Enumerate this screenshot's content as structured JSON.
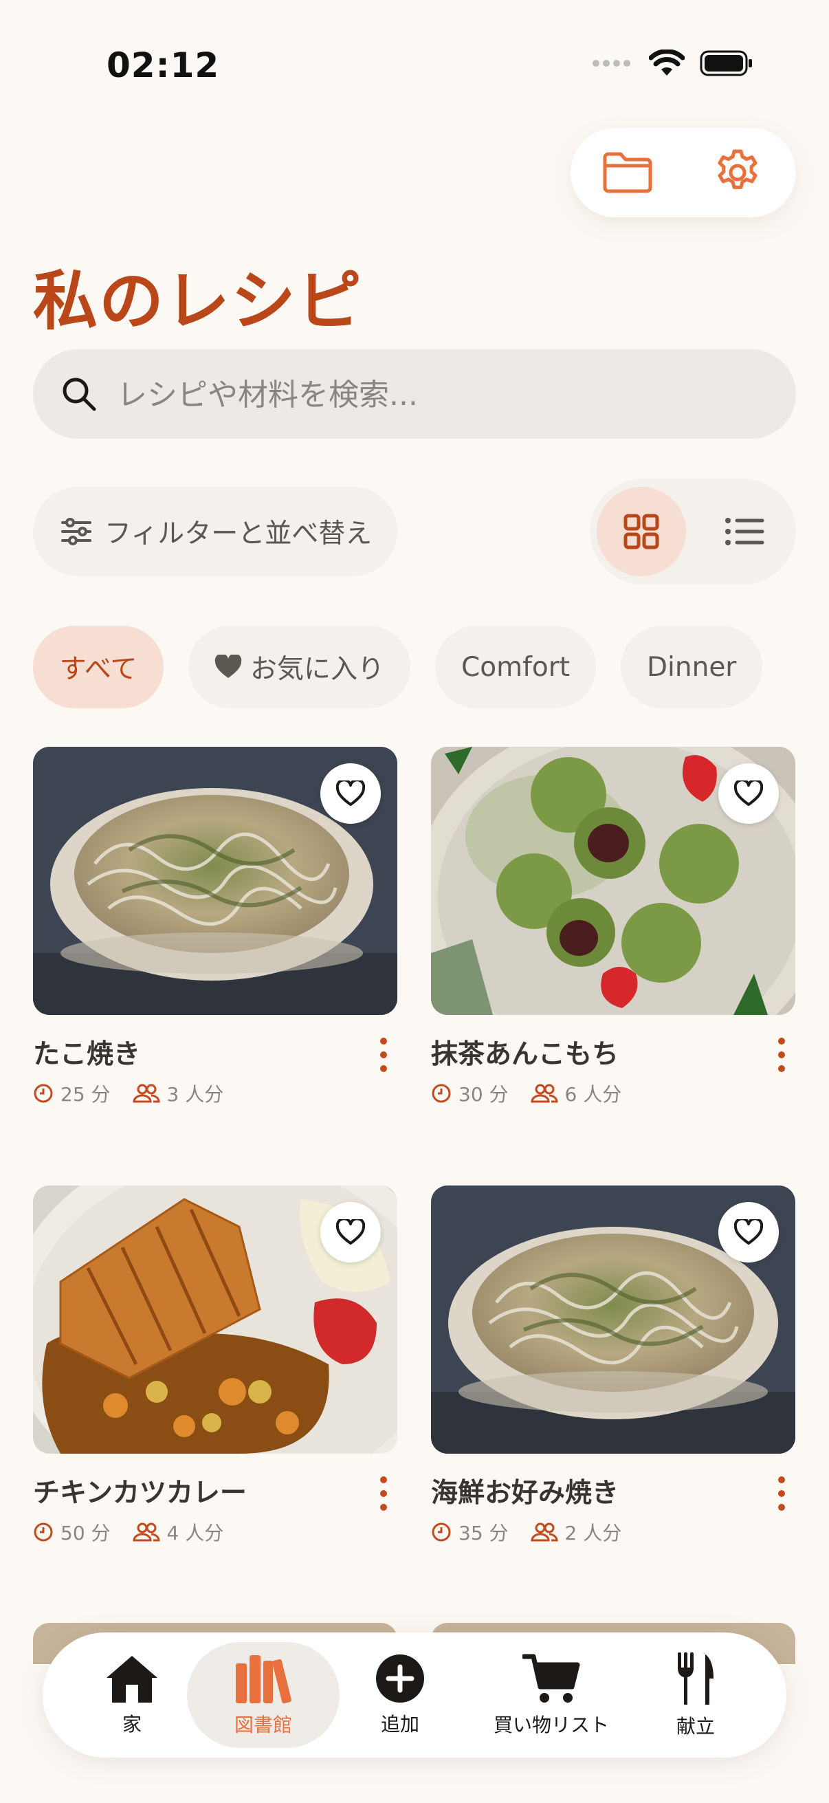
{
  "status_bar": {
    "time": "02:12"
  },
  "page": {
    "title": "私のレシピ"
  },
  "search": {
    "placeholder": "レシピや材料を検索..."
  },
  "filter": {
    "label": "フィルターと並べ替え"
  },
  "categories": [
    {
      "label": "すべて",
      "active": true
    },
    {
      "label": "お気に入り",
      "icon": "heart-icon"
    },
    {
      "label": "Comfort"
    },
    {
      "label": "Dinner"
    }
  ],
  "recipes": [
    {
      "name": "たこ焼き",
      "time": "25 分",
      "servings": "3 人分"
    },
    {
      "name": "抹茶あんこもち",
      "time": "30 分",
      "servings": "6 人分"
    },
    {
      "name": "チキンカツカレー",
      "time": "50 分",
      "servings": "4 人分"
    },
    {
      "name": "海鮮お好み焼き",
      "time": "35 分",
      "servings": "2 人分"
    }
  ],
  "nav": {
    "home": "家",
    "library": "図書館",
    "add": "追加",
    "shopping": "買い物リスト",
    "menu": "献立"
  },
  "colors": {
    "accent": "#B9471A",
    "accent_light": "#E8703D",
    "chip_active_bg": "#F6DED2",
    "background": "#FCF9F5"
  }
}
